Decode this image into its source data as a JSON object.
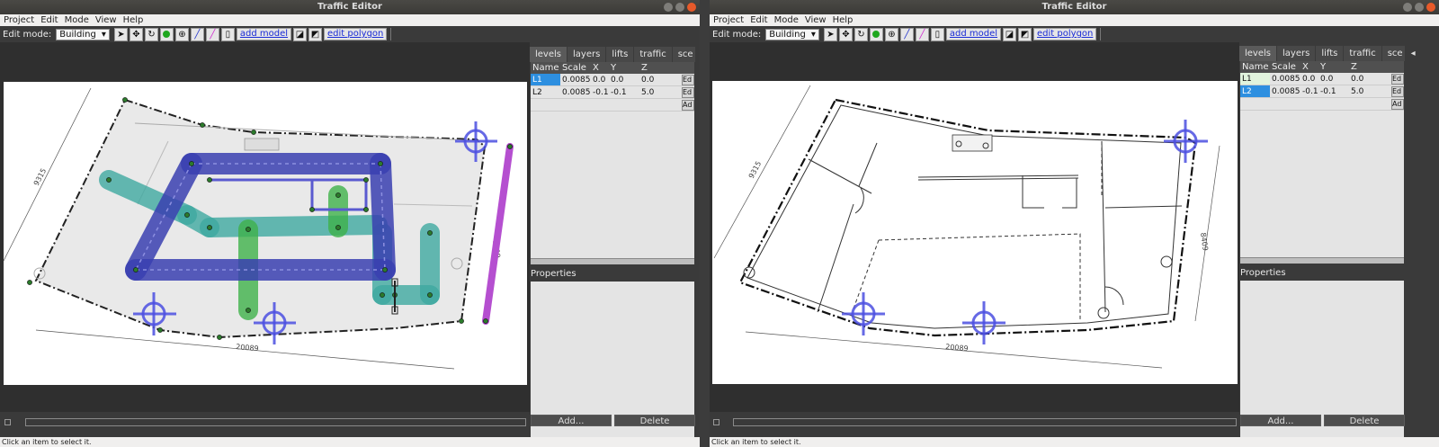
{
  "window_title": "Traffic Editor",
  "menu": [
    "Project",
    "Edit",
    "Mode",
    "View",
    "Help"
  ],
  "toolbar": {
    "edit_mode_label": "Edit mode:",
    "edit_mode_value": "Building",
    "add_model_label": "add model",
    "edit_polygon_label": "edit polygon"
  },
  "tabs": [
    "levels",
    "layers",
    "lifts",
    "traffic",
    "sce"
  ],
  "levels_table": {
    "headers": [
      "Name",
      "Scale",
      "X",
      "Y",
      "Z"
    ],
    "rows": [
      {
        "name": "L1",
        "scale": "0.0085",
        "x": "0.0",
        "y": "0.0",
        "z": "0.0",
        "button": "Ed"
      },
      {
        "name": "L2",
        "scale": "0.0085",
        "x": "-0.1",
        "y": "-0.1",
        "z": "5.0",
        "button": "Ed"
      }
    ],
    "extra_button": "Ad"
  },
  "properties_label": "Properties",
  "add_button": "Add...",
  "delete_button": "Delete",
  "status_text": "Click an item to select it.",
  "drawing_labels": {
    "dim_left": "9315",
    "dim_bottom": "20089",
    "dim_right": "8409"
  },
  "colors": {
    "lane_blue": "#3a3fb0",
    "lane_teal": "#3fa9a0",
    "lane_green": "#3fb24a",
    "wall_purple": "#b54fd0",
    "crosshair": "#4b4fe0"
  }
}
